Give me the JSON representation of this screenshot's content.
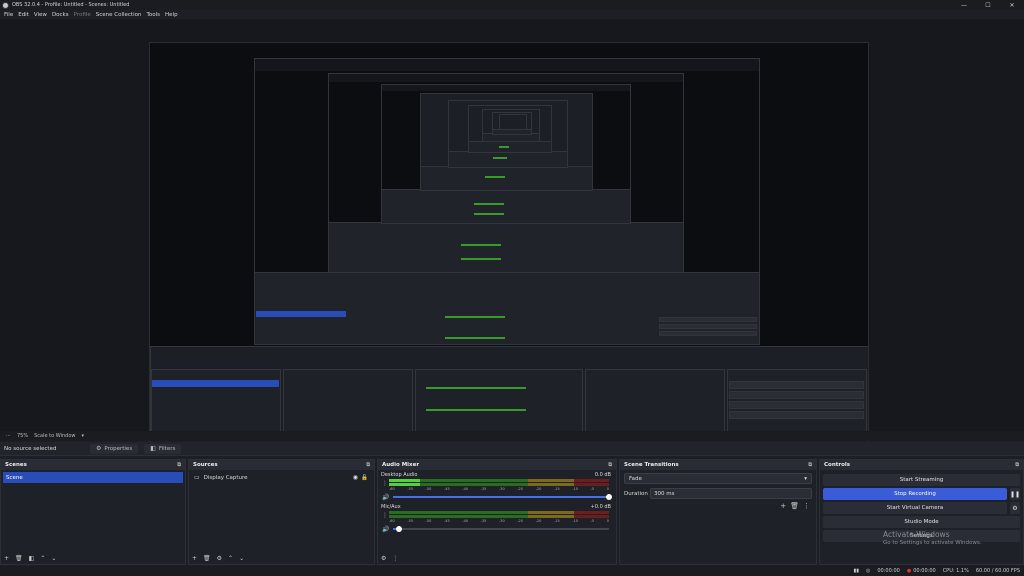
{
  "window": {
    "title": "OBS 32.0.4 - Profile: Untitled - Scenes: Untitled",
    "minimize": "—",
    "maximize": "☐",
    "close": "✕"
  },
  "menu": [
    {
      "label": "File",
      "enabled": true
    },
    {
      "label": "Edit",
      "enabled": true
    },
    {
      "label": "View",
      "enabled": true
    },
    {
      "label": "Docks",
      "enabled": true
    },
    {
      "label": "Profile",
      "enabled": false
    },
    {
      "label": "Scene Collection",
      "enabled": true
    },
    {
      "label": "Tools",
      "enabled": true
    },
    {
      "label": "Help",
      "enabled": true
    }
  ],
  "zoombar": {
    "zoom": "75%",
    "scale_mode": "Scale to Window"
  },
  "source_bar": {
    "no_source": "No source selected",
    "properties": "Properties",
    "filters": "Filters"
  },
  "scenes": {
    "title": "Scenes",
    "items": [
      "Scene"
    ]
  },
  "sources": {
    "title": "Sources",
    "items": [
      "Display Capture"
    ]
  },
  "mixer": {
    "title": "Audio Mixer",
    "ticks": [
      "-60",
      "-55",
      "-50",
      "-45",
      "-40",
      "-35",
      "-30",
      "-25",
      "-20",
      "-15",
      "-10",
      "-5",
      "0"
    ],
    "channels": [
      {
        "name": "Desktop Audio",
        "db": "0.0 dB",
        "level": 0.14,
        "volume": 1.0
      },
      {
        "name": "Mic/Aux",
        "db": "+0.0 dB",
        "level": 0.0,
        "volume": 0.03
      }
    ]
  },
  "transitions": {
    "title": "Scene Transitions",
    "selected": "Fade",
    "duration_label": "Duration",
    "duration_value": "300 ms"
  },
  "controls": {
    "title": "Controls",
    "buttons": [
      "Start Streaming",
      "Stop Recording",
      "Start Virtual Camera",
      "Studio Mode",
      "Settings"
    ],
    "active_index": 1
  },
  "watermark": {
    "line1": "Activate Windows",
    "line2": "Go to Settings to activate Windows."
  },
  "status": {
    "stream_time": "00:00:00",
    "rec_time": "00:00:00",
    "cpu": "CPU: 1.1%",
    "fps": "60.00 / 60.00 FPS"
  }
}
